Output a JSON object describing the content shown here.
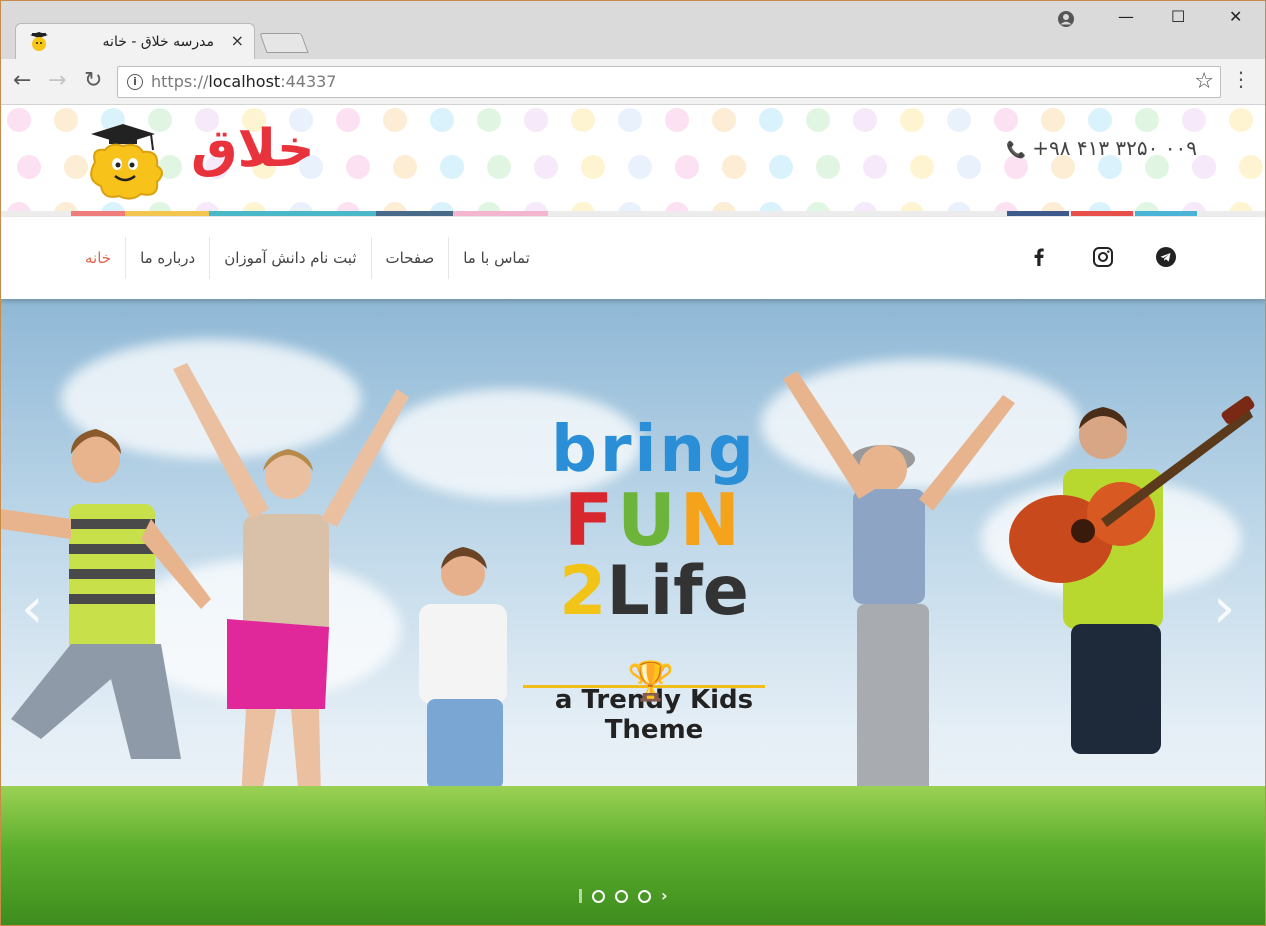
{
  "browser": {
    "tab_title": "مدرسه خلاق - خانه",
    "tab_close": "×",
    "url_scheme": "https://",
    "url_host": "localhost",
    "url_port": ":44337",
    "window_controls": {
      "minimize": "—",
      "maximize": "☐",
      "close": "✕"
    }
  },
  "header": {
    "logo_text": "خلاق",
    "phone": "+۹۸ ۴۱۳ ۳۲۵۰ ۰۰۹"
  },
  "nav": {
    "items": [
      {
        "label": "خانه",
        "active": true
      },
      {
        "label": "درباره ما",
        "active": false
      },
      {
        "label": "ثبت نام دانش آموزان",
        "active": false
      },
      {
        "label": "صفحات",
        "active": false
      },
      {
        "label": "تماس با ما",
        "active": false
      }
    ],
    "social": [
      "facebook-icon",
      "instagram-icon",
      "telegram-icon"
    ]
  },
  "hero": {
    "slogan_line1": "bring",
    "slogan_line2": [
      "F",
      "U",
      "N"
    ],
    "slogan_line3": [
      "2",
      "Life"
    ],
    "tagline": "a Trendy Kids Theme",
    "slide_indicators": 3
  },
  "colors": {
    "accent_active": "#e8604c",
    "logo_red": "#e8323c",
    "fun_f": "#d8282e",
    "fun_u": "#6cb43a",
    "fun_n": "#f5a31b",
    "two": "#f2c418",
    "life": "#333333"
  }
}
